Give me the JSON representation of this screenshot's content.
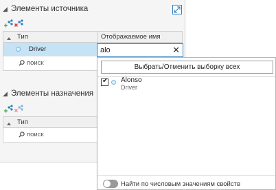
{
  "source_section": {
    "title": "Элементы источника",
    "grid": {
      "col_type": "Тип",
      "col_display": "Отображаемое имя",
      "row_type": "Driver",
      "search_placeholder": "поиск"
    }
  },
  "filter": {
    "value": "alo",
    "clear_glyph": "✕"
  },
  "target_section": {
    "title": "Элементы назначения",
    "grid": {
      "col_type": "Тип",
      "search_placeholder": "поиск"
    }
  },
  "popup": {
    "select_all_label": "Выбрать/Отменить выборку всех",
    "results": [
      {
        "name": "Alonso",
        "type": "Driver",
        "checked": true
      }
    ],
    "toggle_label": "Найти по числовым значениям свойств",
    "toggle_on": false
  },
  "colors": {
    "accent": "#2f7fc1",
    "selection": "#c6e2f5",
    "icon_green": "#4caf50",
    "icon_red": "#e53935",
    "icon_blue": "#2f7fc1"
  },
  "icons": {
    "expanded_caret": "◢",
    "float": "float-panel-icon",
    "add": "add-elements-icon",
    "remove": "remove-elements-icon",
    "search": "magnifier-icon"
  }
}
